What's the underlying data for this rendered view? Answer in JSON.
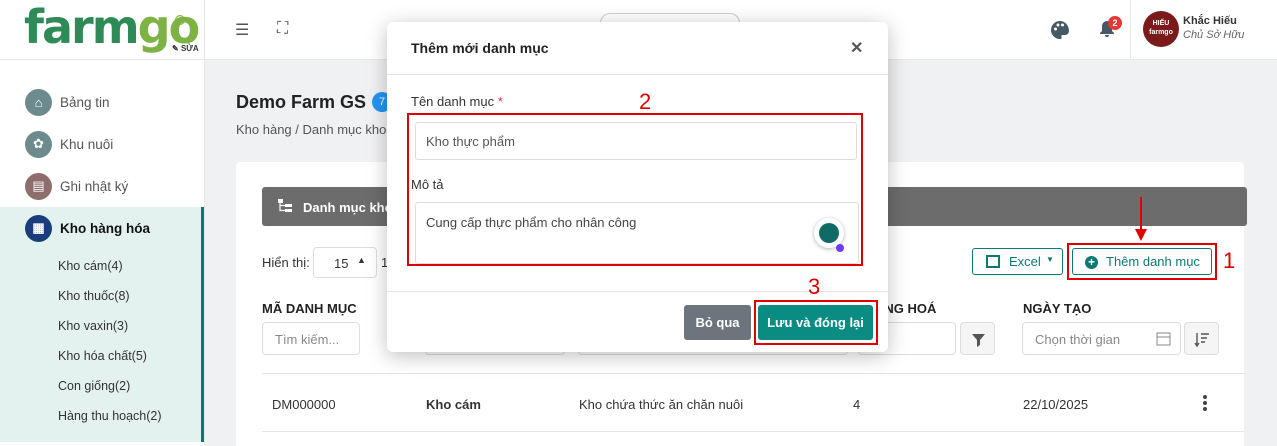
{
  "brand": {
    "logo_part1": "farm",
    "logo_part2": "go",
    "reg": "®",
    "edit_label": "SỬA"
  },
  "sidebar": {
    "items": [
      {
        "label": "Bảng tin",
        "icon": "home-icon"
      },
      {
        "label": "Khu nuôi",
        "icon": "farm-icon"
      },
      {
        "label": "Ghi nhật ký",
        "icon": "journal-icon"
      },
      {
        "label": "Kho hàng hóa",
        "icon": "warehouse-icon",
        "active": true
      }
    ],
    "sub_items": [
      "Kho cám(4)",
      "Kho thuốc(8)",
      "Kho vaxin(3)",
      "Kho hóa chất(5)",
      "Con giống(2)",
      "Hàng thu hoạch(2)"
    ]
  },
  "topbar": {
    "notification_count": "2",
    "user_name": "Khắc Hiếu",
    "user_role": "Chủ Sở Hữu",
    "avatar_line1": "HIẾU",
    "avatar_line2": "farmgo"
  },
  "page": {
    "title": "Demo Farm GS",
    "title_badge": "7",
    "breadcrumb": "Kho hàng  /  Danh mục kho",
    "card_header": "Danh mục kho",
    "show_label": "Hiển thị:",
    "page_size": "15",
    "page_size_tail": "1",
    "excel_label": "Excel",
    "add_label": "Thêm danh mục"
  },
  "table": {
    "headers": {
      "code": "MÃ DANH MỤC",
      "goods": "ẤNG HOÁ",
      "created": "NGÀY TẠO"
    },
    "search_placeholder": "Tìm kiếm...",
    "date_placeholder": "Chọn thời gian",
    "rows": [
      {
        "code": "DM000000",
        "name": "Kho cám",
        "description": "Kho chứa thức ăn chăn nuôi",
        "count": "4",
        "date": "22/10/2025"
      }
    ]
  },
  "modal": {
    "title": "Thêm mới danh mục",
    "name_label": "Tên danh mục",
    "required_mark": "*",
    "name_value": "Kho thực phẩm",
    "desc_label": "Mô tả",
    "desc_value": "Cung cấp thực phẩm cho nhân công",
    "cancel_label": "Bỏ qua",
    "save_label": "Lưu và đóng lại"
  },
  "annotations": {
    "n1": "1",
    "n2": "2",
    "n3": "3"
  },
  "colors": {
    "primary": "#0b7a75",
    "highlight": "#e00000",
    "header_bg": "#6c6c6c"
  }
}
